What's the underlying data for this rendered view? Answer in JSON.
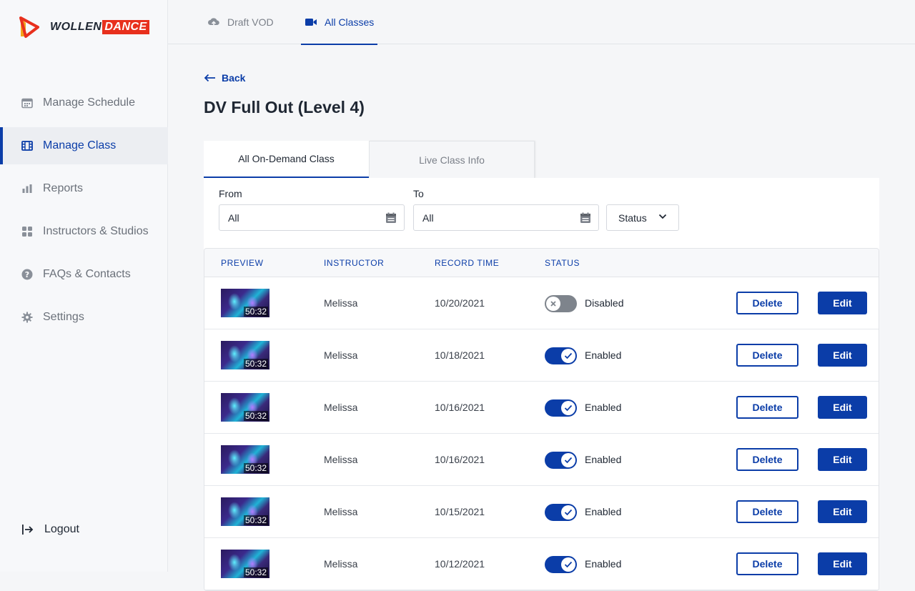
{
  "brand": {
    "part1": "WOLLEN",
    "part2": "DANCE"
  },
  "sidebar": {
    "items": [
      {
        "label": "Manage Schedule",
        "icon": "calendar-icon"
      },
      {
        "label": "Manage Class",
        "icon": "film-icon"
      },
      {
        "label": "Reports",
        "icon": "bar-chart-icon"
      },
      {
        "label": "Instructors & Studios",
        "icon": "grid-icon"
      },
      {
        "label": "FAQs & Contacts",
        "icon": "help-circle-icon"
      },
      {
        "label": "Settings",
        "icon": "gear-icon"
      }
    ],
    "logout": "Logout"
  },
  "topbar": {
    "draft_label": "Draft VOD",
    "all_label": "All Classes"
  },
  "back_label": "Back",
  "page_title": "DV Full Out (Level 4)",
  "tabs": {
    "on_demand": "All On-Demand Class",
    "live": "Live Class Info"
  },
  "filters": {
    "from_label": "From",
    "from_value": "All",
    "to_label": "To",
    "to_value": "All",
    "status_label": "Status"
  },
  "table": {
    "headers": {
      "preview": "PREVIEW",
      "instructor": "INSTRUCTOR",
      "record_time": "RECORD TIME",
      "status": "STATUS"
    },
    "delete_label": "Delete",
    "edit_label": "Edit",
    "rows": [
      {
        "duration": "50:32",
        "instructor": "Melissa",
        "record_time": "10/20/2021",
        "status": "Disabled",
        "enabled": false
      },
      {
        "duration": "50:32",
        "instructor": "Melissa",
        "record_time": "10/18/2021",
        "status": "Enabled",
        "enabled": true
      },
      {
        "duration": "50:32",
        "instructor": "Melissa",
        "record_time": "10/16/2021",
        "status": "Enabled",
        "enabled": true
      },
      {
        "duration": "50:32",
        "instructor": "Melissa",
        "record_time": "10/16/2021",
        "status": "Enabled",
        "enabled": true
      },
      {
        "duration": "50:32",
        "instructor": "Melissa",
        "record_time": "10/15/2021",
        "status": "Enabled",
        "enabled": true
      },
      {
        "duration": "50:32",
        "instructor": "Melissa",
        "record_time": "10/12/2021",
        "status": "Enabled",
        "enabled": true
      }
    ]
  },
  "colors": {
    "accent": "#0b3da8",
    "brand_red": "#e8301d",
    "toggle_off": "#7e848c"
  }
}
